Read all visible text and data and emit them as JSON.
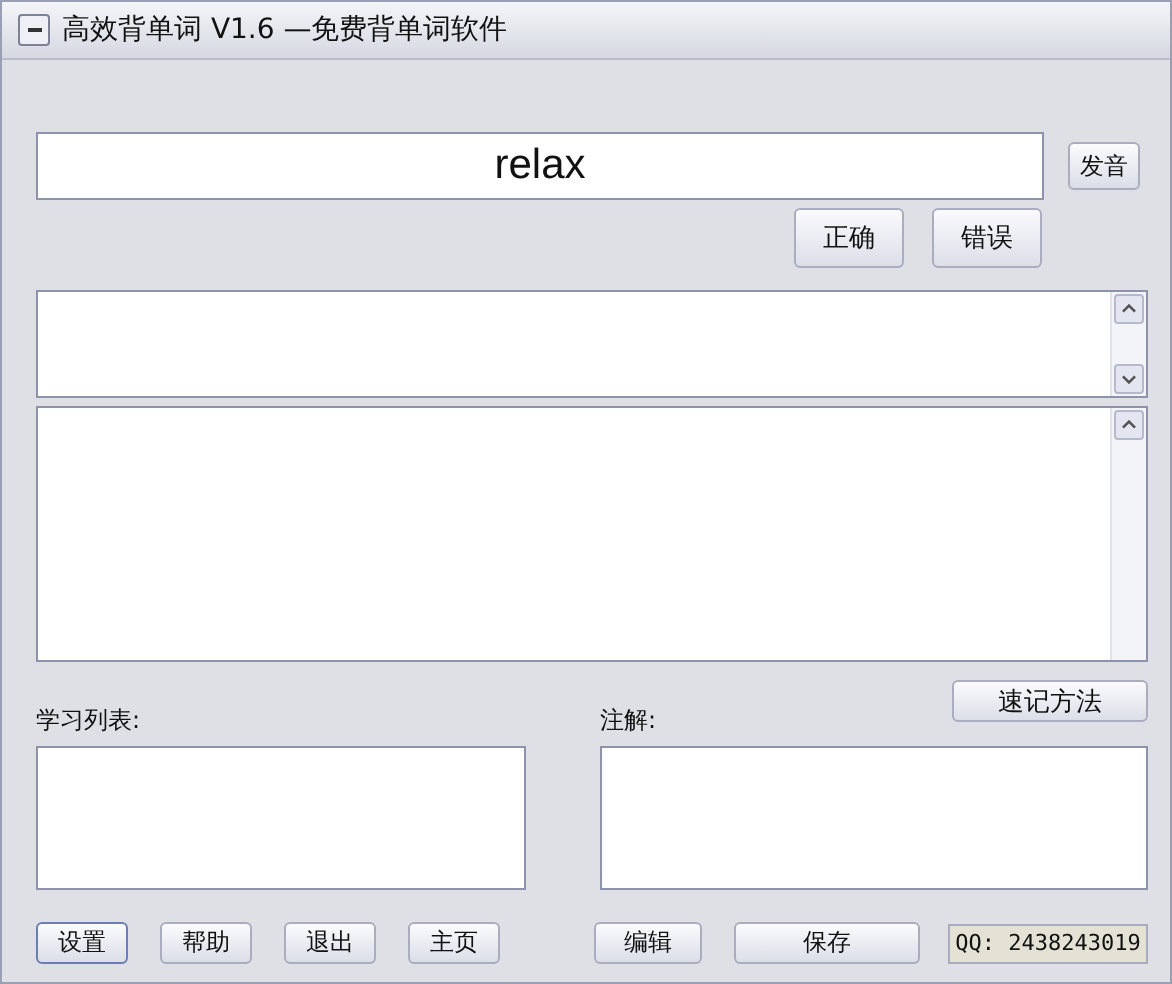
{
  "window": {
    "title": "高效背单词 V1.6  —免费背单词软件"
  },
  "word_field": {
    "value": "relax"
  },
  "pronounce_button": "发音",
  "answer_buttons": [
    "正确",
    "错误"
  ],
  "memory_method_button": "速记方法",
  "study_list": {
    "label": "学习列表:"
  },
  "notes": {
    "label": "注解:"
  },
  "left_buttons": [
    "设置",
    "帮助",
    "退出",
    "主页"
  ],
  "right_buttons": [
    "编辑",
    "保存"
  ],
  "qq": "QQ: 2438243019"
}
